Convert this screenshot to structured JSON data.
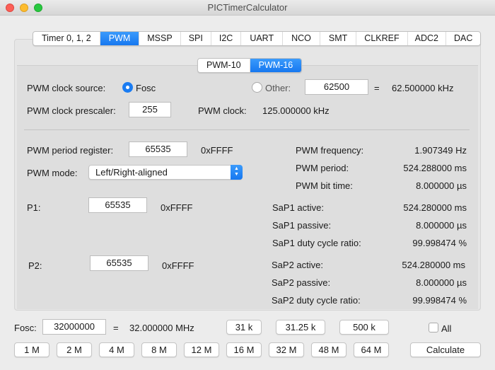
{
  "window": {
    "title": "PICTimerCalculator"
  },
  "tabs": [
    "Timer 0, 1, 2",
    "PWM",
    "MSSP",
    "SPI",
    "I2C",
    "UART",
    "NCO",
    "SMT",
    "CLKREF",
    "ADC2",
    "DAC"
  ],
  "subtabs": [
    "PWM-10",
    "PWM-16"
  ],
  "clock": {
    "source_label": "PWM clock source:",
    "fosc_label": "Fosc",
    "other_label": "Other:",
    "other_value": "62500",
    "eq": "=",
    "other_result": "62.500000  kHz",
    "prescaler_label": "PWM clock prescaler:",
    "prescaler_value": "255",
    "pwm_clock_label": "PWM clock:",
    "pwm_clock_value": "125.000000 kHz"
  },
  "period": {
    "label": "PWM period register:",
    "value": "65535",
    "hex": "0xFFFF",
    "mode_label": "PWM mode:",
    "mode_value": "Left/Right-aligned"
  },
  "results": [
    {
      "label": "PWM frequency:",
      "value": "1.907349 Hz"
    },
    {
      "label": "PWM period:",
      "value": "524.288000 ms"
    },
    {
      "label": "PWM bit time:",
      "value": "8.000000 µs"
    }
  ],
  "p1": {
    "label": "P1:",
    "value": "65535",
    "hex": "0xFFFF",
    "results": [
      {
        "label": "SaP1 active:",
        "value": "524.280000 ms"
      },
      {
        "label": "SaP1 passive:",
        "value": "8.000000 µs"
      },
      {
        "label": "SaP1 duty cycle ratio:",
        "value": "99.998474 %"
      }
    ]
  },
  "p2": {
    "label": "P2:",
    "value": "65535",
    "hex": "0xFFFF",
    "results": [
      {
        "label": "SaP2 active:",
        "value": "524.280000 ms"
      },
      {
        "label": "SaP2 passive:",
        "value": "8.000000 µs"
      },
      {
        "label": "SaP2 duty cycle ratio:",
        "value": "99.998474 %"
      }
    ]
  },
  "bottom": {
    "fosc_label": "Fosc:",
    "fosc_value": "32000000",
    "eq": "=",
    "fosc_result": "32.000000 MHz",
    "presets_top": [
      "31 k",
      "31.25 k",
      "500 k"
    ],
    "presets": [
      "1 M",
      "2 M",
      "4 M",
      "8 M",
      "12 M",
      "16 M",
      "32 M",
      "48 M",
      "64 M"
    ],
    "all_label": "All",
    "calculate": "Calculate"
  },
  "colors": {
    "accent": "#1a7cf2"
  }
}
